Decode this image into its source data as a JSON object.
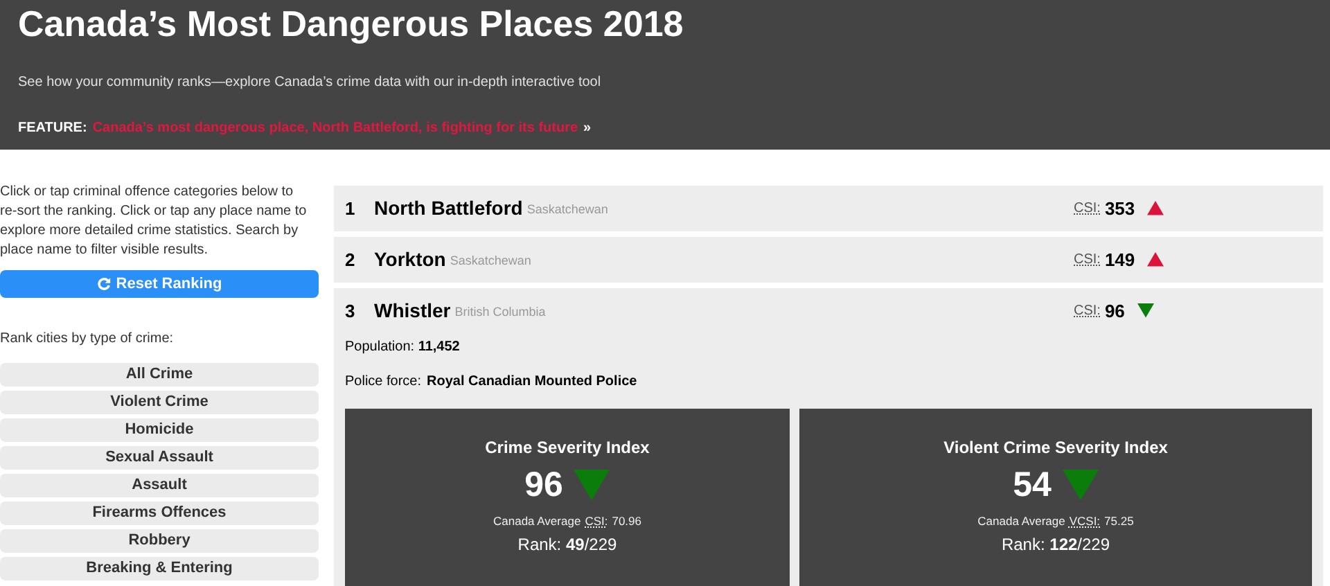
{
  "header": {
    "title": "Canada’s Most Dangerous Places 2018",
    "subtitle": "See how your community ranks—explore Canada’s crime data with our in-depth interactive tool",
    "feature_label": "FEATURE:",
    "feature_link": "Canada’s most dangerous place, North Battleford, is fighting for its future",
    "feature_arrow": "»"
  },
  "sidebar": {
    "intro": "Click or tap criminal offence categories below to re-sort the ranking. Click or tap any place name to explore more detailed crime statistics. Search by place name to filter visible results.",
    "reset_button": "Reset Ranking",
    "categories_label": "Rank cities by type of crime:",
    "categories": [
      "All Crime",
      "Violent Crime",
      "Homicide",
      "Sexual Assault",
      "Assault",
      "Firearms Offences",
      "Robbery",
      "Breaking & Entering"
    ]
  },
  "places": [
    {
      "rank": "1",
      "name": "North Battleford",
      "province": "Saskatchewan",
      "index_label": "CSI:",
      "index_value": "353",
      "kind": "up",
      "expanded": false
    },
    {
      "rank": "2",
      "name": "Yorkton",
      "province": "Saskatchewan",
      "index_label": "CSI:",
      "index_value": "149",
      "kind": "up",
      "expanded": false
    },
    {
      "rank": "3",
      "name": "Whistler",
      "province": "British Columbia",
      "index_label": "CSI:",
      "index_value": "96",
      "kind": "down",
      "expanded": true,
      "details": {
        "population": "Population: **11,452**",
        "police_force_label": "Police force:",
        "police_force": "Royal Canadian Mounted Police",
        "cards": [
          {
            "title": "Crime Severity Index",
            "value": "96",
            "kind": "down",
            "average_label": "Canada Average",
            "average_abbr": "CSI:",
            "average_value": "70.96",
            "rank": "Rank: **49**/229"
          },
          {
            "title": "Violent Crime Severity Index",
            "value": "54",
            "kind": "down",
            "average_label": "Canada Average",
            "average_abbr": "VCSI:",
            "average_value": "75.25",
            "rank": "Rank: **122**/229"
          }
        ]
      }
    }
  ]
}
